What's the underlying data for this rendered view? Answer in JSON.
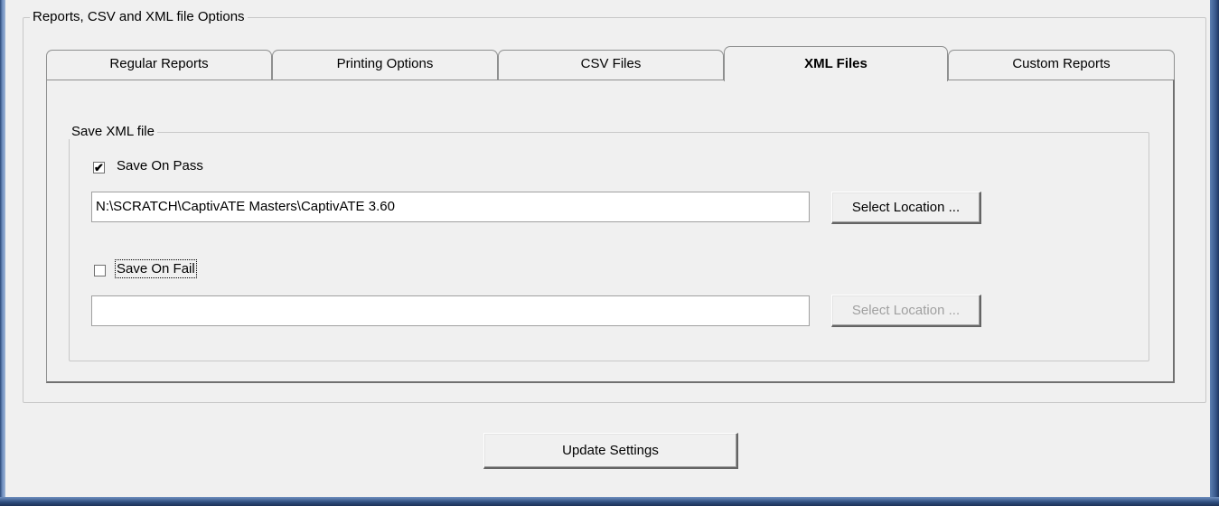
{
  "outer_group": {
    "title": "Reports, CSV and  XML file Options"
  },
  "tabs": [
    {
      "label": "Regular Reports"
    },
    {
      "label": "Printing Options"
    },
    {
      "label": "CSV Files"
    },
    {
      "label": "XML Files",
      "active": true
    },
    {
      "label": "Custom Reports"
    }
  ],
  "xml_group": {
    "title": "Save XML file",
    "save_on_pass": {
      "label": "Save On Pass",
      "checked": true,
      "check_glyph": "✔",
      "path": "N:\\SCRATCH\\CaptivATE Masters\\CaptivATE 3.60",
      "button_label": "Select Location ..."
    },
    "save_on_fail": {
      "label": "Save On Fail",
      "checked": false,
      "path": "",
      "button_label": "Select Location ..."
    }
  },
  "update_button": {
    "label": "Update Settings"
  },
  "colors": {
    "window_bg": "#f0f0f0",
    "frame_blue": "#3a5a8e",
    "disabled_text": "#a0a0a0"
  }
}
